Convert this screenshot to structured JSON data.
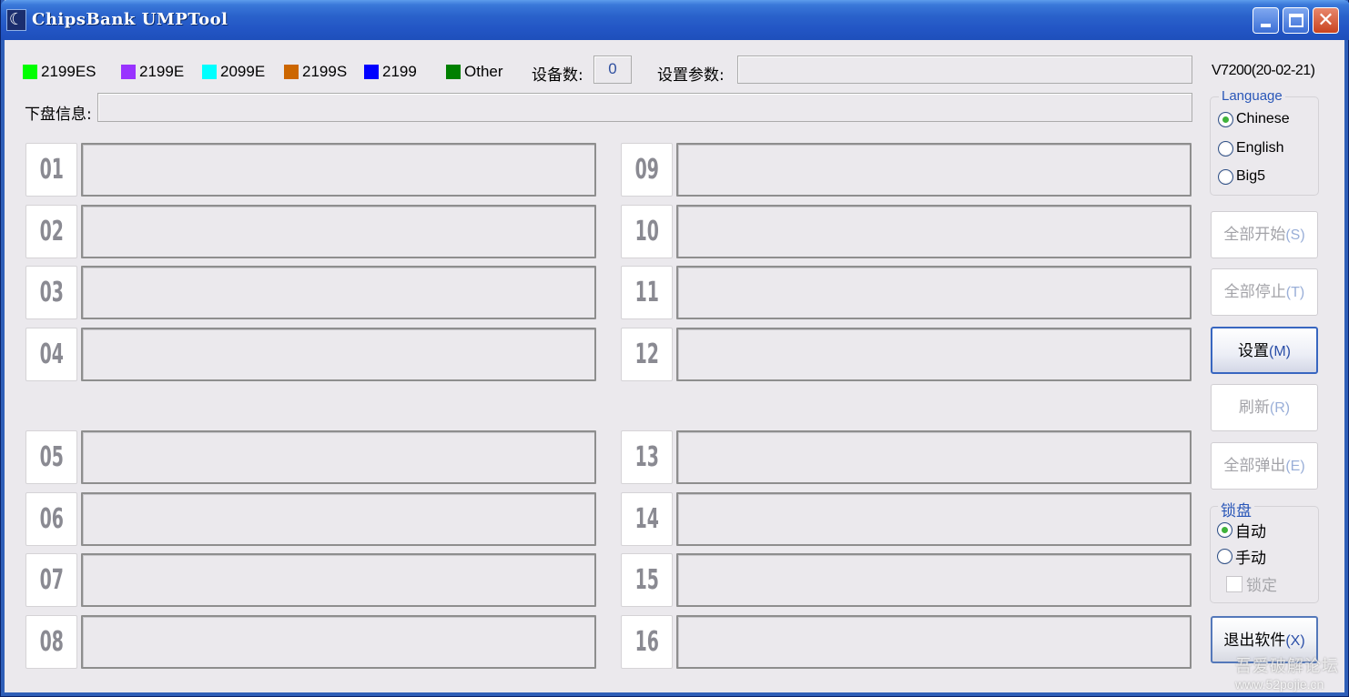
{
  "window": {
    "title": "ChipsBank UMPTool",
    "controls": {
      "minimize": "_",
      "maximize": "□",
      "close": "✕"
    }
  },
  "legend": [
    {
      "label": "2199ES",
      "color": "#00FF00"
    },
    {
      "label": "2199E",
      "color": "#9933FF"
    },
    {
      "label": "2099E",
      "color": "#00FFFF"
    },
    {
      "label": "2199S",
      "color": "#CC6600"
    },
    {
      "label": "2199",
      "color": "#0000FF"
    },
    {
      "label": "Other",
      "color": "#008000"
    }
  ],
  "header": {
    "device_count_label": "设备数:",
    "device_count_value": "0",
    "settings_params_label": "设置参数:",
    "settings_params_value": "",
    "download_info_label": "下盘信息:",
    "download_info_value": "",
    "version": "V7200(20-02-21)"
  },
  "slots": [
    {
      "num": "01",
      "status": ""
    },
    {
      "num": "02",
      "status": ""
    },
    {
      "num": "03",
      "status": ""
    },
    {
      "num": "04",
      "status": ""
    },
    {
      "num": "05",
      "status": ""
    },
    {
      "num": "06",
      "status": ""
    },
    {
      "num": "07",
      "status": ""
    },
    {
      "num": "08",
      "status": ""
    },
    {
      "num": "09",
      "status": ""
    },
    {
      "num": "10",
      "status": ""
    },
    {
      "num": "11",
      "status": ""
    },
    {
      "num": "12",
      "status": ""
    },
    {
      "num": "13",
      "status": ""
    },
    {
      "num": "14",
      "status": ""
    },
    {
      "num": "15",
      "status": ""
    },
    {
      "num": "16",
      "status": ""
    }
  ],
  "language": {
    "title": "Language",
    "options": [
      {
        "label": "Chinese",
        "selected": true
      },
      {
        "label": "English",
        "selected": false
      },
      {
        "label": "Big5",
        "selected": false
      }
    ]
  },
  "buttons": [
    {
      "label": "全部开始",
      "accel": "(S)",
      "state": "disabled"
    },
    {
      "label": "全部停止",
      "accel": "(T)",
      "state": "disabled"
    },
    {
      "label": "设置",
      "accel": "(M)",
      "state": "focused"
    },
    {
      "label": "刷新",
      "accel": "(R)",
      "state": "disabled"
    },
    {
      "label": "全部弹出",
      "accel": "(E)",
      "state": "disabled"
    }
  ],
  "lock": {
    "title": "锁盘",
    "options": [
      {
        "label": "自动",
        "selected": true
      },
      {
        "label": "手动",
        "selected": false
      }
    ],
    "checkbox_label": "锁定",
    "checkbox_checked": false
  },
  "exit_button": {
    "label": "退出软件",
    "accel": "(X)"
  },
  "watermark": {
    "line1": "吾爱破解论坛",
    "line2": "www.52pojie.cn"
  }
}
